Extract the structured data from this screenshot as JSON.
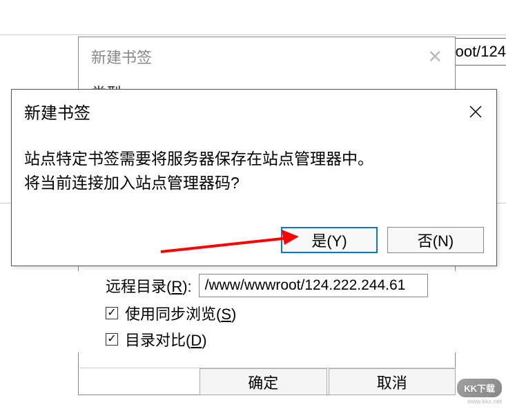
{
  "back_dialog": {
    "title": "新建书签",
    "partial_text": "类型"
  },
  "top_right_path": "oot/124",
  "front_dialog": {
    "title": "新建书签",
    "message_line1": "站点特定书签需要将服务器保存在站点管理器中。",
    "message_line2": "将当前连接加入站点管理器码?",
    "yes_button": "是(Y)",
    "no_button": "否(N)"
  },
  "settings": {
    "remote_dir_label": "远程目录(R):",
    "remote_dir_value": "/www/wwwroot/124.222.244.61",
    "sync_browse_label": "使用同步浏览(S)",
    "dir_compare_label": "目录对比(D)",
    "sync_checked": true,
    "dir_compare_checked": true
  },
  "bottom_buttons": {
    "ok": "确定",
    "cancel": "取消"
  },
  "watermark": {
    "text": "KK下载",
    "url": "www.kkx.net"
  }
}
